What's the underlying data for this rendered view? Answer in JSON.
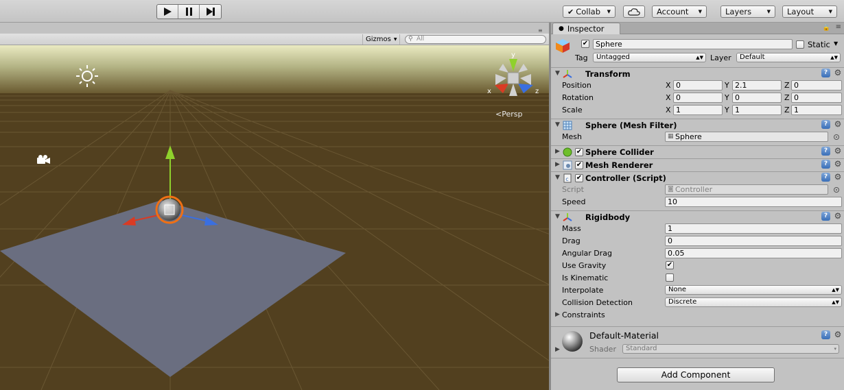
{
  "toolbar": {
    "play_icon": "play-icon",
    "pause_icon": "pause-icon",
    "step_icon": "step-icon",
    "collab_label": "Collab",
    "cloud_icon": "cloud-icon",
    "account_label": "Account",
    "layers_label": "Layers",
    "layout_label": "Layout"
  },
  "scene": {
    "gizmos_label": "Gizmos",
    "search_placeholder": "All",
    "persp_label": "Persp",
    "axis_labels": {
      "x": "x",
      "y": "y",
      "z": "z"
    },
    "colors": {
      "ground": "#52401f",
      "sky": "#eaeac2",
      "plane": "#6a6e80",
      "x_axis": "#d93b24",
      "y_axis": "#8fd12c",
      "z_axis": "#3a6fe0",
      "selection": "#f07014"
    }
  },
  "inspector": {
    "tab_label": "Inspector",
    "object": {
      "active": true,
      "name": "Sphere",
      "static_label": "Static",
      "static": false,
      "tag_label": "Tag",
      "tag": "Untagged",
      "layer_label": "Layer",
      "layer": "Default"
    },
    "transform": {
      "title": "Transform",
      "rows": [
        {
          "label": "Position",
          "x": "0",
          "y": "2.1",
          "z": "0"
        },
        {
          "label": "Rotation",
          "x": "0",
          "y": "0",
          "z": "0"
        },
        {
          "label": "Scale",
          "x": "1",
          "y": "1",
          "z": "1"
        }
      ],
      "axis": {
        "x": "X",
        "y": "Y",
        "z": "Z"
      }
    },
    "mesh_filter": {
      "title": "Sphere (Mesh Filter)",
      "mesh_label": "Mesh",
      "mesh_value": "Sphere"
    },
    "sphere_collider": {
      "title": "Sphere Collider",
      "enabled": true
    },
    "mesh_renderer": {
      "title": "Mesh Renderer",
      "enabled": true
    },
    "controller": {
      "title": "Controller (Script)",
      "enabled": true,
      "script_label": "Script",
      "script_value": "Controller",
      "speed_label": "Speed",
      "speed_value": "10"
    },
    "rigidbody": {
      "title": "Rigidbody",
      "mass_label": "Mass",
      "mass": "1",
      "drag_label": "Drag",
      "drag": "0",
      "angular_drag_label": "Angular Drag",
      "angular_drag": "0.05",
      "use_gravity_label": "Use Gravity",
      "use_gravity": true,
      "is_kinematic_label": "Is Kinematic",
      "is_kinematic": false,
      "interpolate_label": "Interpolate",
      "interpolate": "None",
      "collision_label": "Collision Detection",
      "collision": "Discrete",
      "constraints_label": "Constraints"
    },
    "material": {
      "name": "Default-Material",
      "shader_label": "Shader",
      "shader": "Standard"
    },
    "add_component_label": "Add Component",
    "help_glyph": "?",
    "gear_glyph": "⚙"
  }
}
